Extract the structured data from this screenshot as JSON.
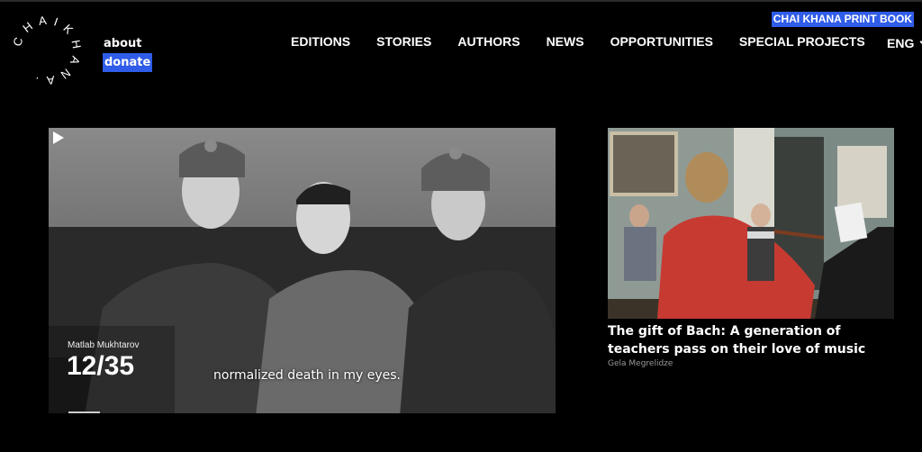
{
  "logo": {
    "text": "CHAIKHANA"
  },
  "side_links": {
    "about": "about",
    "donate": "donate"
  },
  "print_book": "CHAI KHANA PRINT BOOK",
  "nav": [
    "EDITIONS",
    "STORIES",
    "AUTHORS",
    "NEWS",
    "OPPORTUNITIES",
    "SPECIAL PROJECTS"
  ],
  "language": "ENG",
  "hero": {
    "credit": "Matlab Mukhtarov",
    "counter": "12/35",
    "subtitle": "normalized death in my eyes.",
    "photo_description": "black-and-white photo of three young soldiers in fur hats sitting on a sofa",
    "play_icon": "play-icon"
  },
  "featured_card": {
    "title": "The gift of Bach: A generation of teachers pass on their love of music",
    "author": "Gela Megrelidze",
    "photo_description": "woman in red sweater playing piano while children play violin in a classroom"
  },
  "colors": {
    "accent": "#2f5ce8",
    "background": "#000000"
  }
}
